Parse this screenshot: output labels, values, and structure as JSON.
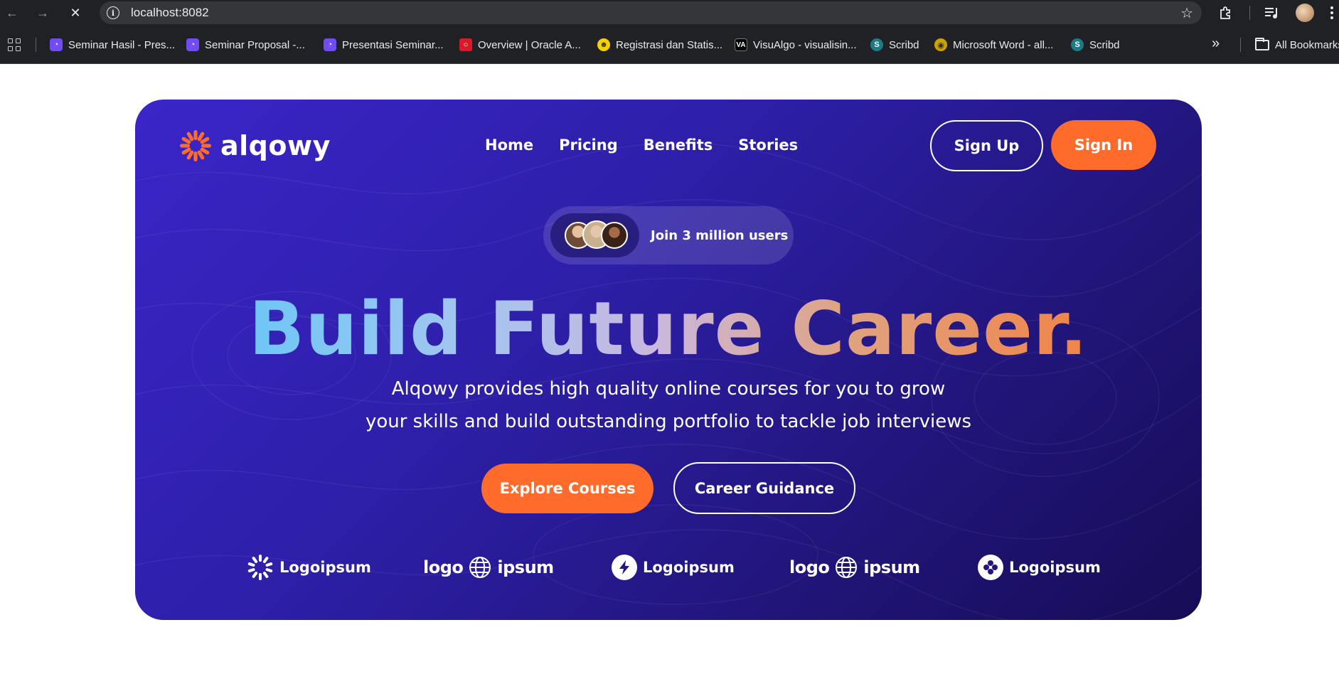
{
  "browser": {
    "url": "localhost:8082",
    "nav": {
      "back_icon": "←",
      "forward_icon": "→",
      "reload_icon": "✕"
    },
    "bookmarks": [
      {
        "label": "Seminar Hasil - Pres...",
        "icon": "pres-icon"
      },
      {
        "label": "Seminar Proposal -...",
        "icon": "pres-icon"
      },
      {
        "label": "Presentasi Seminar...",
        "icon": "pres-icon"
      },
      {
        "label": "Overview | Oracle A...",
        "icon": "oracle-icon"
      },
      {
        "label": "Registrasi dan Statis...",
        "icon": "registrasi-icon"
      },
      {
        "label": "VisuAlgo - visualisin...",
        "icon": "visualgo-icon"
      },
      {
        "label": "Scribd",
        "icon": "scribd-icon"
      },
      {
        "label": "Microsoft Word - all...",
        "icon": "word-icon"
      },
      {
        "label": "Scribd",
        "icon": "scribd-icon"
      }
    ],
    "more_icon": "»",
    "all_bookmarks": "All Bookmarks"
  },
  "site": {
    "brand": "alqowy",
    "menu": [
      "Home",
      "Pricing",
      "Benefits",
      "Stories"
    ],
    "signup": "Sign Up",
    "signin": "Sign In",
    "pill_text": "Join 3 million users",
    "headline": "Build Future Career.",
    "subtitle_line1": "Alqowy provides high quality online courses for you to grow",
    "subtitle_line2": "your skills and build outstanding portfolio to tackle job interviews",
    "cta_primary": "Explore Courses",
    "cta_secondary": "Career Guidance",
    "partners": [
      {
        "name": "Logoipsum",
        "icon": "sunburst-logo-icon"
      },
      {
        "name_left": "logo",
        "name_right": "ipsum",
        "icon": "globe-logo-icon"
      },
      {
        "name": "Logoipsum",
        "icon": "bolt-logo-icon"
      },
      {
        "name_left": "logo",
        "name_right": "ipsum",
        "icon": "globe-logo-icon"
      },
      {
        "name": "Logoipsum",
        "icon": "clover-logo-icon"
      }
    ],
    "colors": {
      "accent": "#ff6b2b",
      "hero_start": "#3a25c8",
      "hero_end": "#160c55"
    }
  }
}
